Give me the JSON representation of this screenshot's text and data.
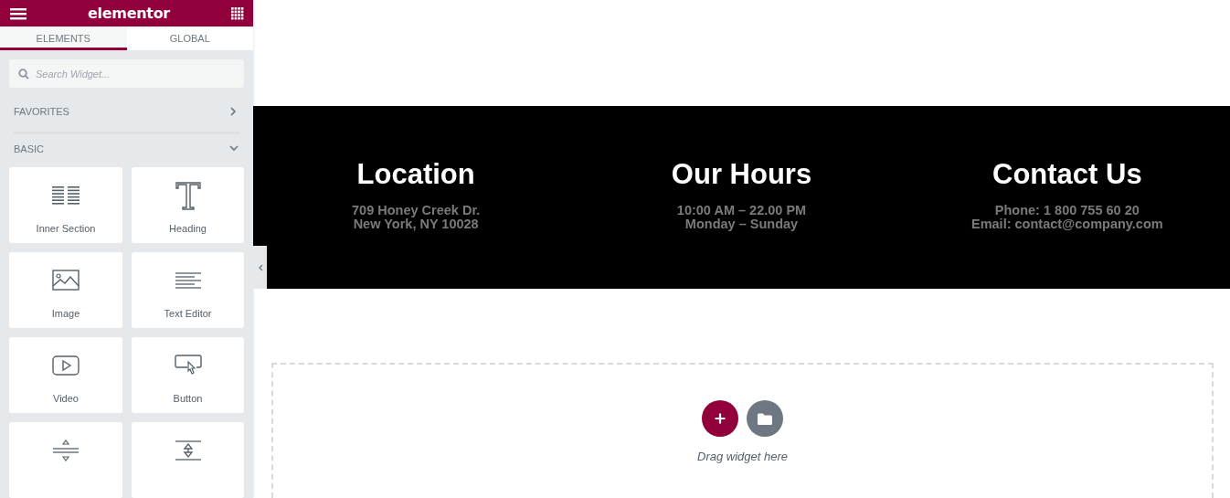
{
  "sidebar": {
    "logo": "elementor",
    "tabs": [
      {
        "label": "ELEMENTS",
        "selected": true
      },
      {
        "label": "GLOBAL",
        "selected": false
      }
    ],
    "search": {
      "placeholder": "Search Widget..."
    },
    "categories": [
      {
        "label": "FAVORITES",
        "expanded": false
      },
      {
        "label": "BASIC",
        "expanded": true
      }
    ],
    "widgets": [
      {
        "kind": "inner-section",
        "label": "Inner Section"
      },
      {
        "kind": "heading",
        "label": "Heading"
      },
      {
        "kind": "image",
        "label": "Image"
      },
      {
        "kind": "text-editor",
        "label": "Text Editor"
      },
      {
        "kind": "video",
        "label": "Video"
      },
      {
        "kind": "button",
        "label": "Button"
      },
      {
        "kind": "divider"
      },
      {
        "kind": "spacer"
      }
    ]
  },
  "section": {
    "columns": [
      {
        "title": "Location",
        "lines": [
          "709 Honey Creek Dr.",
          "New York, NY 10028"
        ]
      },
      {
        "title": "Our Hours",
        "lines": [
          "10:00 AM – 22.00 PM",
          "Monday – Sunday"
        ]
      },
      {
        "title": "Contact Us",
        "lines": [
          "Phone: 1 800 755 60 20",
          "Email: contact@company.com"
        ]
      }
    ]
  },
  "drop_zone": {
    "hint": "Drag widget here"
  }
}
